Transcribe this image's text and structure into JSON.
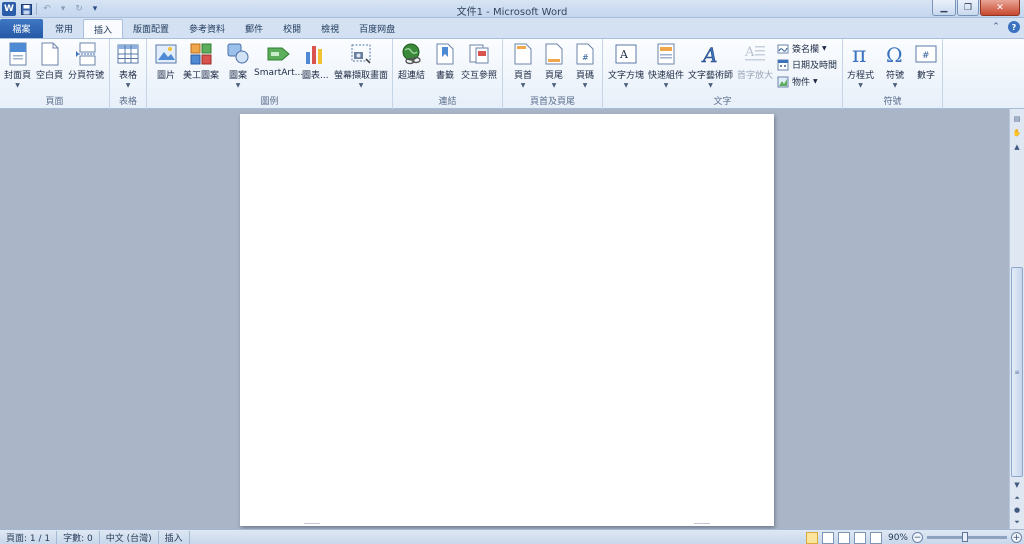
{
  "window": {
    "title": "文件1 - Microsoft Word",
    "app_logo": "W"
  },
  "qat": {
    "icons": [
      "save-icon",
      "undo-icon",
      "redo-icon",
      "customize-icon"
    ]
  },
  "tabs": {
    "file": "檔案",
    "items": [
      {
        "label": "常用",
        "active": false
      },
      {
        "label": "插入",
        "active": true
      },
      {
        "label": "版面配置",
        "active": false
      },
      {
        "label": "參考資料",
        "active": false
      },
      {
        "label": "郵件",
        "active": false
      },
      {
        "label": "校閱",
        "active": false
      },
      {
        "label": "檢視",
        "active": false
      },
      {
        "label": "百度网盘",
        "active": false
      }
    ],
    "help": "?"
  },
  "ribbon": {
    "pages": {
      "label": "頁面",
      "cover": "封面頁",
      "blank": "空白頁",
      "page_break": "分頁符號"
    },
    "tables": {
      "label": "表格",
      "table": "表格"
    },
    "illustrations": {
      "label": "圖例",
      "picture": "圖片",
      "clipart": "美工圖案",
      "shapes": "圖案",
      "smartart": "SmartArt...",
      "chart": "圖表...",
      "screenshot": "螢幕擷取畫面"
    },
    "links": {
      "label": "連結",
      "hyperlink": "超連結",
      "bookmark": "書籤",
      "crossref": "交互參照"
    },
    "header_footer": {
      "label": "頁首及頁尾",
      "header": "頁首",
      "footer": "頁尾",
      "page_number": "頁碼"
    },
    "text": {
      "label": "文字",
      "textbox": "文字方塊",
      "quickparts": "快速組件",
      "wordart": "文字藝術師",
      "dropcap": "首字放大",
      "signature": "簽名欄",
      "datetime": "日期及時間",
      "object": "物件"
    },
    "symbols": {
      "label": "符號",
      "equation": "方程式",
      "symbol": "符號",
      "number": "數字"
    }
  },
  "statusbar": {
    "page": "頁面: 1 / 1",
    "words": "字數: 0",
    "language": "中文 (台灣)",
    "mode": "插入",
    "zoom": "90%"
  },
  "colors": {
    "accent": "#2659a6",
    "ribbon_bg": "#f3f7fc",
    "doc_bg": "#aab6c8"
  }
}
